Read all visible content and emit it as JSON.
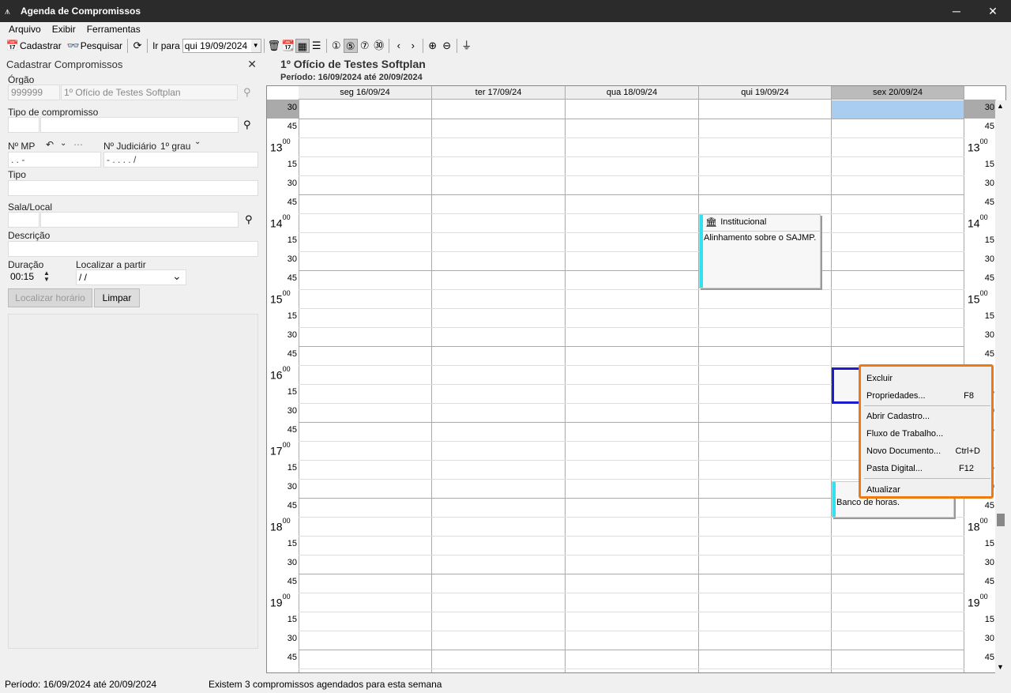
{
  "window": {
    "title": "Agenda de Compromissos",
    "minimize": "─",
    "close": "✕"
  },
  "menu": [
    "Arquivo",
    "Exibir",
    "Ferramentas"
  ],
  "toolbar": {
    "cadastrar": "Cadastrar",
    "pesquisar": "Pesquisar",
    "ir_para": "Ir para",
    "date": "qui 19/09/2024"
  },
  "left_panel": {
    "title": "Cadastrar Compromissos",
    "orgao_label": "Órgão",
    "orgao_code": "999999",
    "orgao_name": "1º Ofício de Testes Softplan",
    "tipo_compromisso_label": "Tipo de compromisso",
    "nmp_label": "Nº MP",
    "nmp_value": " .    .      -",
    "njud_label": "Nº Judiciário",
    "grau": "1º grau",
    "njud_value": "       - .    . . .    /",
    "tipo_label": "Tipo",
    "sala_label": "Sala/Local",
    "descricao_label": "Descrição",
    "duracao_label": "Duração",
    "duracao_value": "00:15",
    "localizar_label": "Localizar a partir",
    "localizar_value": " /  /",
    "btn_localizar": "Localizar horário",
    "btn_limpar": "Limpar"
  },
  "calendar": {
    "heading": "1º Ofício de Testes Softplan",
    "period": "Período: 16/09/2024 até 20/09/2024",
    "days": [
      "seg 16/09/24",
      "ter 17/09/24",
      "qua 18/09/24",
      "qui 19/09/24",
      "sex 20/09/24"
    ],
    "hours": [
      "13",
      "14",
      "15",
      "16",
      "17",
      "18",
      "19"
    ],
    "minutes_sup": "00",
    "appointment1": {
      "title": "Institucional",
      "text": "Alinhamento sobre o SAJMP."
    },
    "appointment2": {
      "text": "Banco de horas."
    }
  },
  "context_menu": {
    "excluir": "Excluir",
    "propriedades": "Propriedades...",
    "propriedades_key": "F8",
    "abrir": "Abrir Cadastro...",
    "fluxo": "Fluxo de Trabalho...",
    "novo": "Novo Documento...",
    "novo_key": "Ctrl+D",
    "pasta": "Pasta Digital...",
    "pasta_key": "F12",
    "atualizar": "Atualizar"
  },
  "status": {
    "period": "Período: 16/09/2024 até 20/09/2024",
    "message": "Existem 3 compromissos agendados para esta semana"
  },
  "colors": {
    "accent": "#ee7b12",
    "selection": "#a9cdf0",
    "appointment_bar": "#2fe2ef"
  }
}
